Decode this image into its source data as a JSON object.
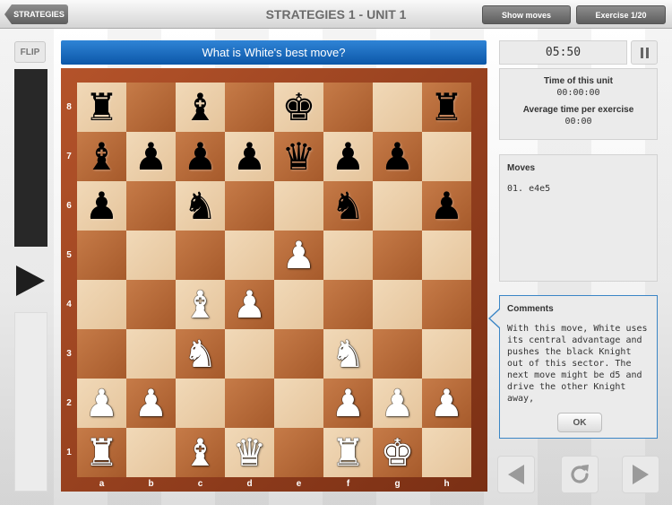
{
  "header": {
    "back_label": "STRATEGIES",
    "title": "STRATEGIES 1 - UNIT 1",
    "show_moves_label": "Show moves",
    "exercise_label": "Exercise 1/20"
  },
  "left": {
    "flip_label": "FLIP"
  },
  "question": "What is White's best move?",
  "timer": "05:50",
  "time_panel": {
    "unit_label": "Time of this unit",
    "unit_time": "00:00:00",
    "avg_label": "Average time per exercise",
    "avg_time": "00:00"
  },
  "moves": {
    "heading": "Moves",
    "list": "01. e4e5"
  },
  "comments": {
    "heading": "Comments",
    "text": "With this move, White uses its central advantage and pushes the black Knight out of this sector. The next move might be d5 and drive the other Knight away,",
    "ok_label": "OK"
  },
  "board": {
    "files": [
      "a",
      "b",
      "c",
      "d",
      "e",
      "f",
      "g",
      "h"
    ],
    "ranks": [
      "8",
      "7",
      "6",
      "5",
      "4",
      "3",
      "2",
      "1"
    ],
    "rows": [
      [
        "bR",
        "",
        "bB",
        "",
        "bK",
        "",
        "",
        "bR"
      ],
      [
        "bB",
        "bP",
        "bP",
        "bP",
        "bQ",
        "bP",
        "bP",
        ""
      ],
      [
        "bP",
        "",
        "bN",
        "",
        "",
        "bN",
        "",
        "bP"
      ],
      [
        "",
        "",
        "",
        "",
        "wP",
        "",
        "",
        ""
      ],
      [
        "",
        "",
        "wB",
        "wP",
        "",
        "",
        "",
        ""
      ],
      [
        "",
        "",
        "wN",
        "",
        "",
        "wN",
        "",
        ""
      ],
      [
        "wP",
        "wP",
        "",
        "",
        "",
        "wP",
        "wP",
        "wP"
      ],
      [
        "wR",
        "",
        "wB",
        "wQ",
        "",
        "wR",
        "wK",
        ""
      ]
    ]
  },
  "icons": {
    "play": "play-icon",
    "pause": "pause-icon",
    "prev": "arrow-left-icon",
    "refresh": "refresh-icon",
    "next": "arrow-right-icon"
  }
}
